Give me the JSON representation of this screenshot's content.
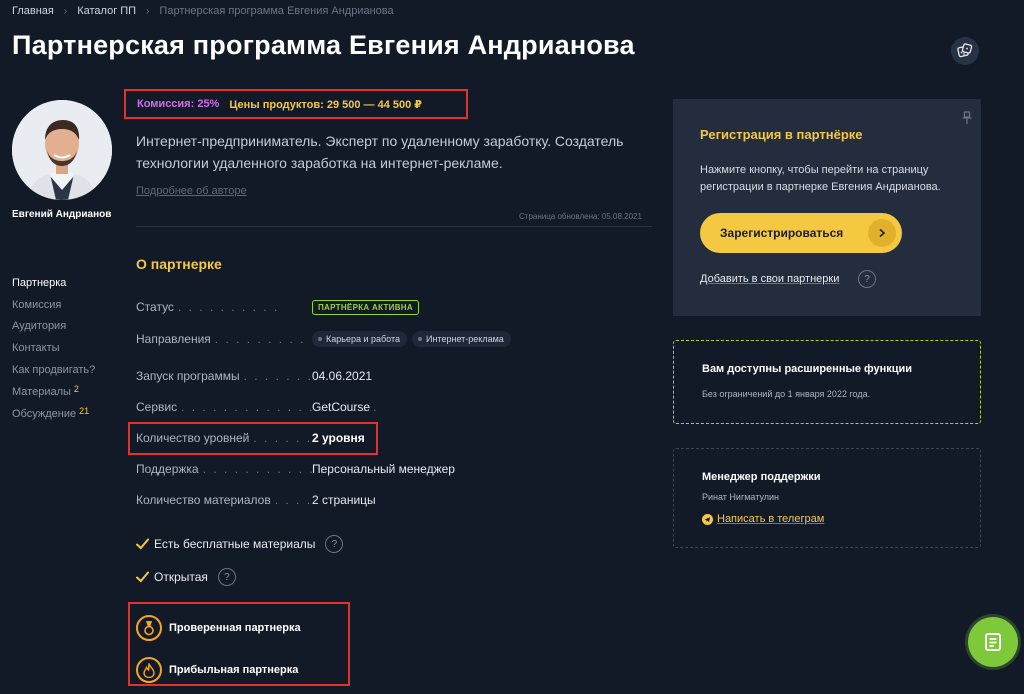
{
  "breadcrumb": {
    "items": [
      "Главная",
      "Каталог ПП"
    ],
    "current": "Партнерская программа Евгения Андрианова"
  },
  "page_title": "Партнерская программа Евгения Андрианова",
  "author": {
    "name": "Евгений Андрианов",
    "description": "Интернет-предприниматель. Эксперт по удаленному заработку. Создатель технологии удаленного заработка на интернет-рекламе.",
    "more_link": "Подробнее об авторе"
  },
  "summary": {
    "commission": "Комиссия: 25%",
    "prices": "Цены продуктов: 29 500 — 44 500 ₽"
  },
  "updated": "Страница обновлена: 05.08.2021",
  "side_nav": [
    {
      "label": "Партнерка",
      "count": ""
    },
    {
      "label": "Комиссия",
      "count": ""
    },
    {
      "label": "Аудитория",
      "count": ""
    },
    {
      "label": "Контакты",
      "count": ""
    },
    {
      "label": "Как продвигать?",
      "count": ""
    },
    {
      "label": "Материалы",
      "count": "2"
    },
    {
      "label": "Обсуждение",
      "count": "21"
    }
  ],
  "about": {
    "title": "О партнерке",
    "status_label": "Статус",
    "status_value": "ПАРТНЁРКА АКТИВНА",
    "directions_label": "Направления",
    "directions": [
      "Карьера и работа",
      "Интернет-реклама"
    ],
    "launch_label": "Запуск программы",
    "launch_value": "04.06.2021",
    "service_label": "Сервис",
    "service_value": "GetCourse",
    "levels_label": "Количество уровней",
    "levels_value": "2 уровня",
    "support_label": "Поддержка",
    "support_value": "Персональный менеджер",
    "materials_label": "Количество материалов",
    "materials_value": "2 страницы"
  },
  "checks": {
    "free_materials": "Есть бесплатные материалы",
    "open": "Открытая"
  },
  "features": {
    "verified": "Проверенная партнерка",
    "profitable": "Прибыльная партнерка"
  },
  "registration": {
    "title": "Регистрация в партнёрке",
    "text": "Нажмите кнопку, чтобы перейти на страницу регистрации в партнерке Евгения Андрианова.",
    "button": "Зарегистрироваться",
    "add_link": "Добавить в свои партнерки"
  },
  "extended": {
    "title": "Вам доступны расширенные функции",
    "text": "Без ограничений до 1 января 2022 года."
  },
  "manager": {
    "title": "Менеджер поддержки",
    "name": "Ринат Нигматулин",
    "link": "Написать в телеграм"
  },
  "help_glyph": "?",
  "colors": {
    "background": "#121a28",
    "accent_yellow": "#f5c842",
    "accent_purple": "#d16ee8",
    "accent_green": "#9ad424",
    "highlight_red": "#e2322e",
    "card": "#242d3d"
  }
}
